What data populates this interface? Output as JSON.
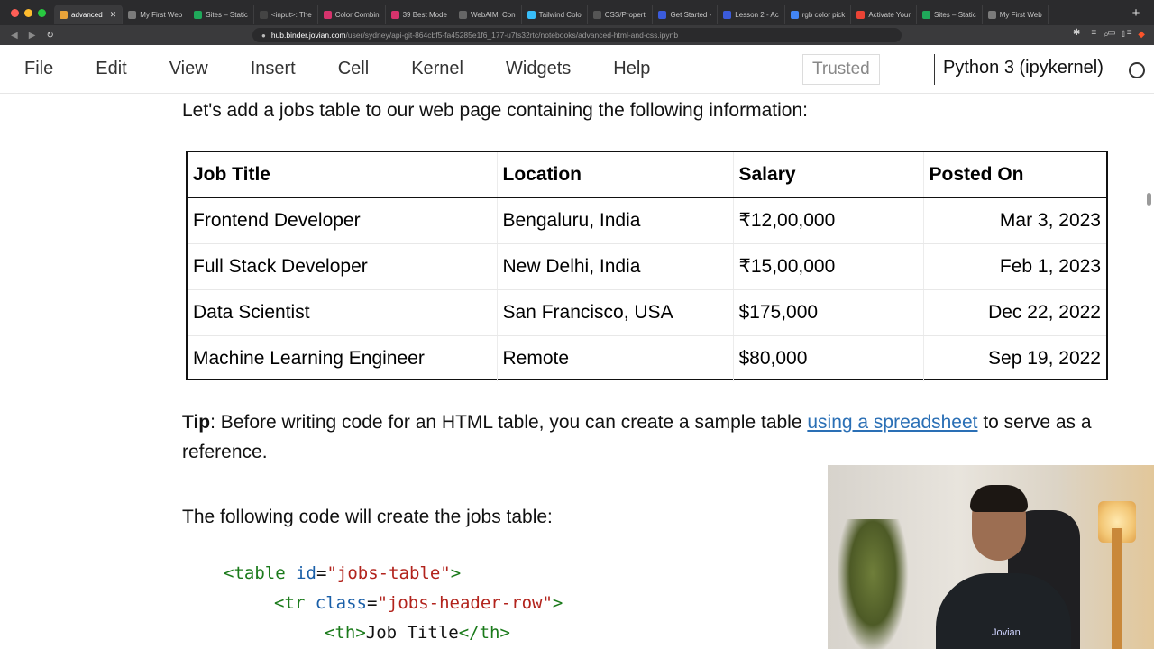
{
  "browser": {
    "tabs": [
      {
        "label": "advanced",
        "color": "#e8a33a",
        "active": true
      },
      {
        "label": "My First Web",
        "color": "#7b7b7b"
      },
      {
        "label": "Sites – Static",
        "color": "#1fa85a"
      },
      {
        "label": "<input>: The",
        "color": "#444444"
      },
      {
        "label": "Color Combin",
        "color": "#d6336c"
      },
      {
        "label": "39 Best Mode",
        "color": "#d6336c"
      },
      {
        "label": "WebAIM: Con",
        "color": "#666666"
      },
      {
        "label": "Tailwind Colo",
        "color": "#38bdf8"
      },
      {
        "label": "CSS/Properti",
        "color": "#555555"
      },
      {
        "label": "Get Started -",
        "color": "#3b5bdb"
      },
      {
        "label": "Lesson 2 - Ac",
        "color": "#3b5bdb"
      },
      {
        "label": "rgb color pick",
        "color": "#4285f4"
      },
      {
        "label": "Activate Your",
        "color": "#ea4335"
      },
      {
        "label": "Sites – Static",
        "color": "#1fa85a"
      },
      {
        "label": "My First Web",
        "color": "#7b7b7b"
      }
    ],
    "url_host": "hub.binder.jovian.com",
    "url_path": "/user/sydney/api-git-864cbf5-fa45285e1f6_177-u7fs32rtc/notebooks/advanced-html-and-css.ipynb"
  },
  "menubar": {
    "items": [
      "File",
      "Edit",
      "View",
      "Insert",
      "Cell",
      "Kernel",
      "Widgets",
      "Help"
    ],
    "trusted": "Trusted",
    "kernel": "Python 3 (ipykernel)"
  },
  "notebook": {
    "intro": "Let's add a jobs table to our web page containing the following information:",
    "jobs_table": {
      "headers": [
        "Job Title",
        "Location",
        "Salary",
        "Posted On"
      ],
      "rows": [
        [
          "Frontend Developer",
          "Bengaluru, India",
          "₹12,00,000",
          "Mar 3, 2023"
        ],
        [
          "Full Stack Developer",
          "New Delhi, India",
          "₹15,00,000",
          "Feb 1, 2023"
        ],
        [
          "Data Scientist",
          "San Francisco, USA",
          "$175,000",
          "Dec 22, 2022"
        ],
        [
          "Machine Learning Engineer",
          "Remote",
          "$80,000",
          "Sep 19, 2022"
        ]
      ]
    },
    "tip_label": "Tip",
    "tip_text_before": ": Before writing code for an HTML table, you can create a sample table ",
    "tip_link": "using a spreadsheet",
    "tip_text_after": " to serve as a reference.",
    "following": "The following code will create the jobs table:",
    "code": {
      "line1_tag_open": "<table",
      "line1_attr": "id",
      "line1_value": "\"jobs-table\"",
      "line1_close": ">",
      "line2_tag_open": "<tr",
      "line2_attr": "class",
      "line2_value": "\"jobs-header-row\"",
      "line2_close": ">",
      "line3_open": "<th>",
      "line3_text": "Job Title",
      "line3_close": "</th>"
    }
  },
  "webcam": {
    "logo": "Jovian"
  }
}
